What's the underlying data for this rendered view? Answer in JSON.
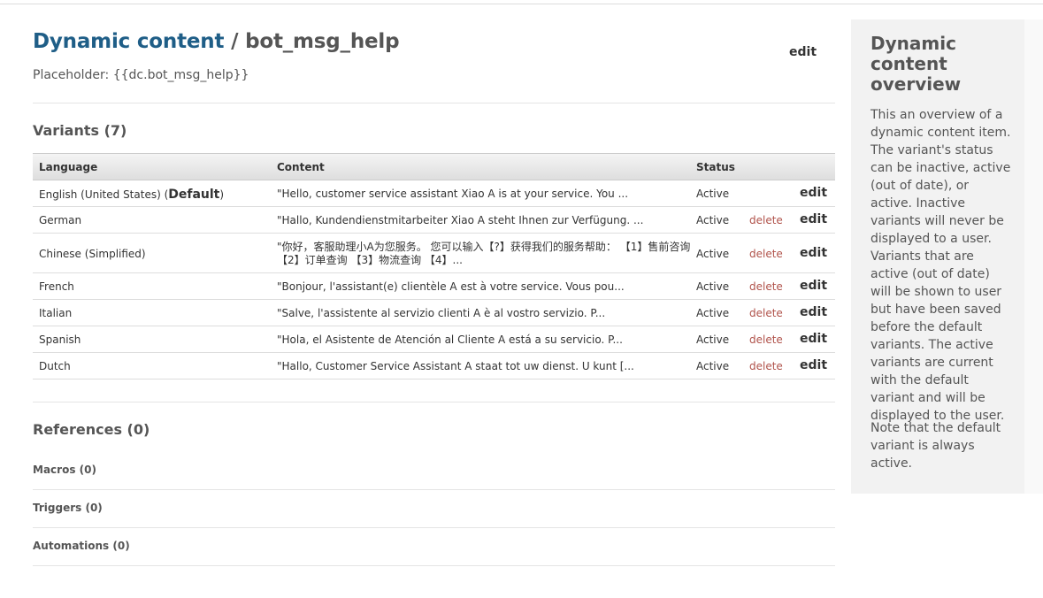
{
  "header": {
    "crumb": "Dynamic content",
    "separator": "/",
    "name": "bot_msg_help",
    "placeholder": "Placeholder: {{dc.bot_msg_help}}",
    "edit_label": "edit"
  },
  "variants": {
    "title": "Variants (7)",
    "columns": {
      "language": "Language",
      "content": "Content",
      "status": "Status"
    },
    "rows": [
      {
        "language": "English (United States) (",
        "default_label": "Default",
        "language_suffix": ")",
        "content": "\"Hello, customer service assistant Xiao A is at your service. You ...",
        "status": "Active",
        "delete": "",
        "edit": "edit"
      },
      {
        "language": "German",
        "content": "\"Hallo, Kundendienstmitarbeiter Xiao A steht Ihnen zur Verfügung. ...",
        "status": "Active",
        "delete": "delete",
        "edit": "edit"
      },
      {
        "language": "Chinese (Simplified)",
        "content": "\"你好，客服助理小A为您服务。 您可以输入【?】获得我们的服务帮助： 【1】售前咨询 【2】订单查询 【3】物流查询 【4】...",
        "status": "Active",
        "delete": "delete",
        "edit": "edit"
      },
      {
        "language": "French",
        "content": "\"Bonjour, l'assistant(e) clientèle A est à votre service. Vous pou...",
        "status": "Active",
        "delete": "delete",
        "edit": "edit"
      },
      {
        "language": "Italian",
        "content": "\"Salve, l'assistente al servizio clienti A è al vostro servizio. P...",
        "status": "Active",
        "delete": "delete",
        "edit": "edit"
      },
      {
        "language": "Spanish",
        "content": "\"Hola, el Asistente de Atención al Cliente A está a su servicio. P...",
        "status": "Active",
        "delete": "delete",
        "edit": "edit"
      },
      {
        "language": "Dutch",
        "content": "\"Hallo, Customer Service Assistant A staat tot uw dienst. U kunt [...",
        "status": "Active",
        "delete": "delete",
        "edit": "edit"
      }
    ]
  },
  "references": {
    "title": "References (0)",
    "macros": "Macros (0)",
    "triggers": "Triggers (0)",
    "automations": "Automations (0)"
  },
  "sidebar": {
    "title": "Dynamic content overview",
    "paragraph1": "This an overview of a dynamic content item. The variant's status can be inactive, active (out of date), or active. Inactive variants will never be displayed to a user. Variants that are active (out of date) will be shown to user but have been saved before the default variants. The active variants are current with the default variant and will be displayed to the user.",
    "paragraph2": "Note that the default variant is always active."
  },
  "colors": {
    "crumb": "#1f5e87",
    "delete": "#b0524a"
  }
}
